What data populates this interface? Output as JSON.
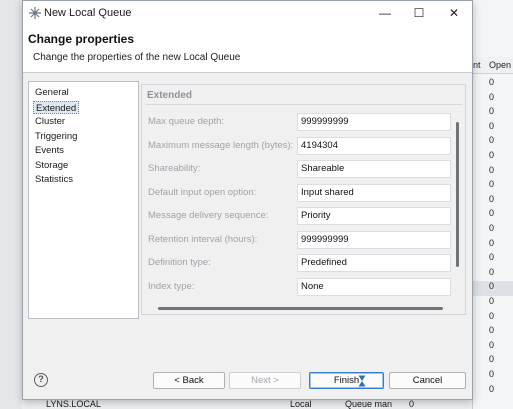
{
  "window": {
    "title": "New Local Queue",
    "minimize_glyph": "—",
    "maximize_glyph": "☐",
    "close_glyph": "✕"
  },
  "header": {
    "title": "Change properties",
    "description": "Change the properties of the new Local Queue"
  },
  "nav": {
    "items": [
      {
        "label": "General",
        "selected": false
      },
      {
        "label": "Extended",
        "selected": true
      },
      {
        "label": "Cluster",
        "selected": false
      },
      {
        "label": "Triggering",
        "selected": false
      },
      {
        "label": "Events",
        "selected": false
      },
      {
        "label": "Storage",
        "selected": false
      },
      {
        "label": "Statistics",
        "selected": false
      }
    ]
  },
  "section": {
    "title": "Extended",
    "properties": [
      {
        "label": "Max queue depth:",
        "value": "999999999"
      },
      {
        "label": "Maximum message length (bytes):",
        "value": "4194304"
      },
      {
        "label": "Shareability:",
        "value": "Shareable"
      },
      {
        "label": "Default input open option:",
        "value": "Input shared"
      },
      {
        "label": "Message delivery sequence:",
        "value": "Priority"
      },
      {
        "label": "Retention interval (hours):",
        "value": "999999999"
      },
      {
        "label": "Definition type:",
        "value": "Predefined"
      },
      {
        "label": "Index type:",
        "value": "None"
      }
    ]
  },
  "buttons": {
    "help": "?",
    "back": "< Back",
    "next": "Next >",
    "finish": "Finish",
    "cancel": "Cancel"
  },
  "background_table": {
    "col_1": "nt",
    "col_2": "Open",
    "open_values": [
      "0",
      "0",
      "0",
      "0",
      "0",
      "0",
      "0",
      "0",
      "0",
      "0",
      "0",
      "0",
      "0",
      "0",
      "0",
      "0",
      "0",
      "0",
      "0",
      "0",
      "0",
      "0"
    ]
  },
  "background_row": {
    "name": "LYNS.LOCAL",
    "type": "Local",
    "usage": "Queue man",
    "count": "0"
  },
  "colors": {
    "accent": "#3b7cc9",
    "selection": "#dfe7f1",
    "disabled_text": "#9ea3a9"
  }
}
